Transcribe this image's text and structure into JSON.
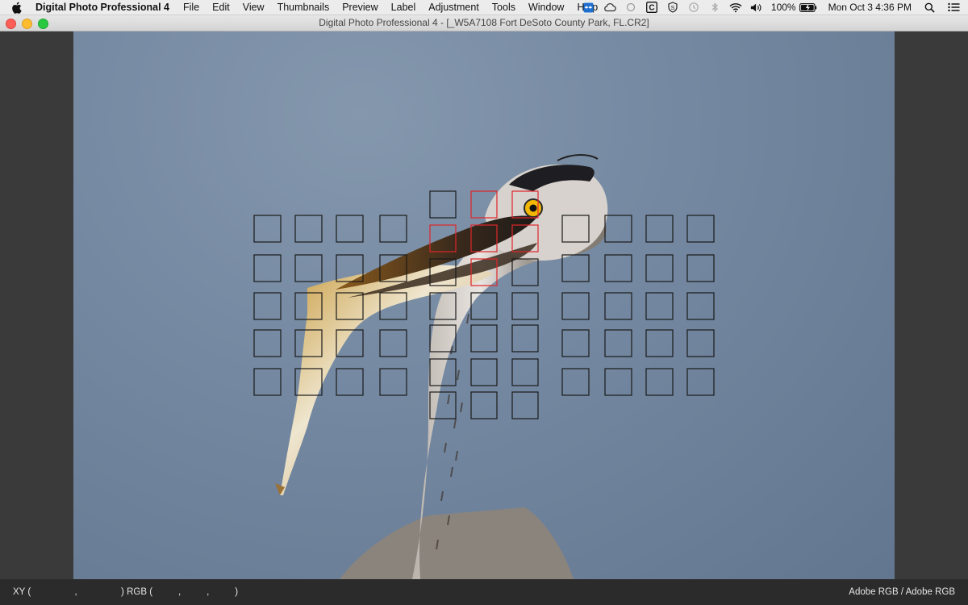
{
  "menubar": {
    "app_name": "Digital Photo Professional 4",
    "items": [
      "File",
      "Edit",
      "View",
      "Thumbnails",
      "Preview",
      "Label",
      "Adjustment",
      "Tools",
      "Window",
      "Help"
    ],
    "battery": "100%",
    "clock": "Mon Oct 3  4:36 PM"
  },
  "window": {
    "title": "Digital Photo Professional 4 - [_W5A7108  Fort DeSoto County Park, FL.CR2]"
  },
  "statusbar": {
    "xy_label": "XY (",
    "xy_sep": ",",
    "xy_close": ")",
    "rgb_label": "RGB (",
    "rgb_sep1": ",",
    "rgb_sep2": ",",
    "rgb_close": ")",
    "color_space": "Adobe RGB / Adobe RGB"
  },
  "af_points": {
    "colors": {
      "inactive": "#1a1a1a",
      "active": "#e0262b"
    },
    "active_count": 6,
    "total_count": 61
  },
  "icons": [
    "apple-icon",
    "dropbox-icon",
    "creative-cloud-icon",
    "time-machine-icon",
    "bluetooth-icon",
    "wifi-icon",
    "volume-icon",
    "battery-icon",
    "spotlight-icon",
    "notification-center-icon"
  ]
}
